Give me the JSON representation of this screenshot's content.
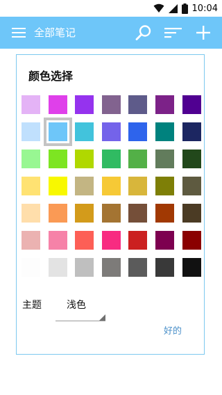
{
  "status_bar": {
    "time": "10:04",
    "icons": [
      "wifi-icon",
      "signal-icon",
      "battery-icon"
    ]
  },
  "toolbar": {
    "title": "全部笔记",
    "background": "#6ec6f9",
    "icons": [
      "menu-icon",
      "search-icon",
      "sort-icon",
      "add-icon"
    ]
  },
  "dialog": {
    "title": "颜色选择",
    "border_color": "#7cc8ef",
    "selected_color_index": 8,
    "colors": [
      "#e4b3f6",
      "#df40ea",
      "#9533ee",
      "#82638f",
      "#5e5b8a",
      "#7c2288",
      "#500091",
      "#c0e0fd",
      "#6ec6f9",
      "#42c3dc",
      "#7463ea",
      "#2e64ec",
      "#00827e",
      "#1c2661",
      "#98f792",
      "#7de522",
      "#b0d800",
      "#30bb62",
      "#53b047",
      "#627c5c",
      "#22481b",
      "#ffe272",
      "#f8f800",
      "#c3b583",
      "#f6c936",
      "#d8b63b",
      "#7e7f07",
      "#5e5a40",
      "#ffdeab",
      "#fa9a55",
      "#d39b1b",
      "#a47432",
      "#754f39",
      "#a13903",
      "#4b3b24",
      "#ebb2b1",
      "#f682a8",
      "#fd5f56",
      "#f82b81",
      "#cb2020",
      "#7d0050",
      "#8a0000",
      "#fdfdfd",
      "#e3e3e3",
      "#bfbfbf",
      "#7d7b79",
      "#5b5b5b",
      "#393939",
      "#111111"
    ],
    "theme_label": "主题",
    "theme_value": "浅色",
    "ok_label": "好的"
  }
}
